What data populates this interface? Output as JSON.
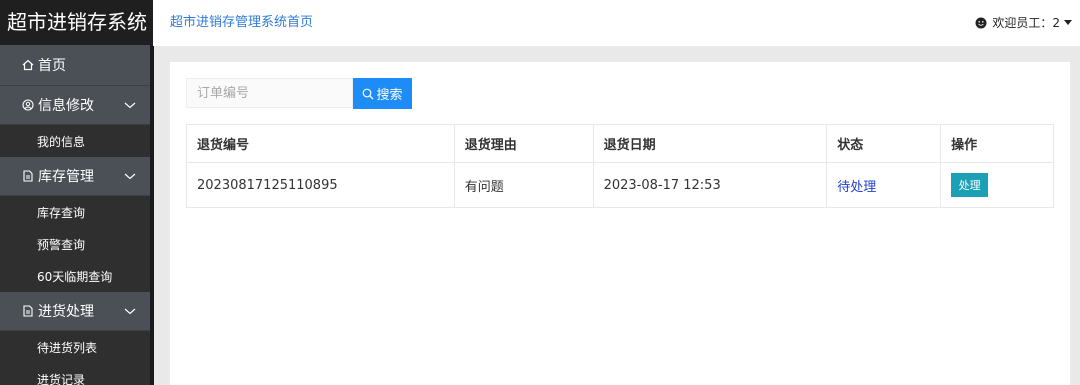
{
  "app": {
    "brand": "超市进销存系统",
    "page_title": "超市进销存管理系统首页"
  },
  "user": {
    "greeting": "欢迎员工：2"
  },
  "sidebar": {
    "home": "首页",
    "groups": [
      {
        "label": "信息修改",
        "icon": "user-circle-icon",
        "items": [
          "我的信息"
        ]
      },
      {
        "label": "库存管理",
        "icon": "document-icon",
        "items": [
          "库存查询",
          "预警查询",
          "60天临期查询"
        ]
      },
      {
        "label": "进货处理",
        "icon": "document-icon",
        "items": [
          "待进货列表",
          "进货记录"
        ]
      }
    ]
  },
  "search": {
    "placeholder": "订单编号",
    "button_label": "搜索"
  },
  "table": {
    "headers": [
      "退货编号",
      "退货理由",
      "退货日期",
      "状态",
      "操作"
    ],
    "rows": [
      {
        "id": "20230817125110895",
        "reason": "有问题",
        "date": "2023-08-17 12:53",
        "status": "待处理",
        "action": "处理"
      }
    ]
  },
  "colors": {
    "accent": "#1e8cf6",
    "sidebar_bg": "#2f2f2f",
    "nav_group_bg": "#4b4f56",
    "status_text": "#1f3fd1",
    "action_button": "#1ba0b6"
  }
}
